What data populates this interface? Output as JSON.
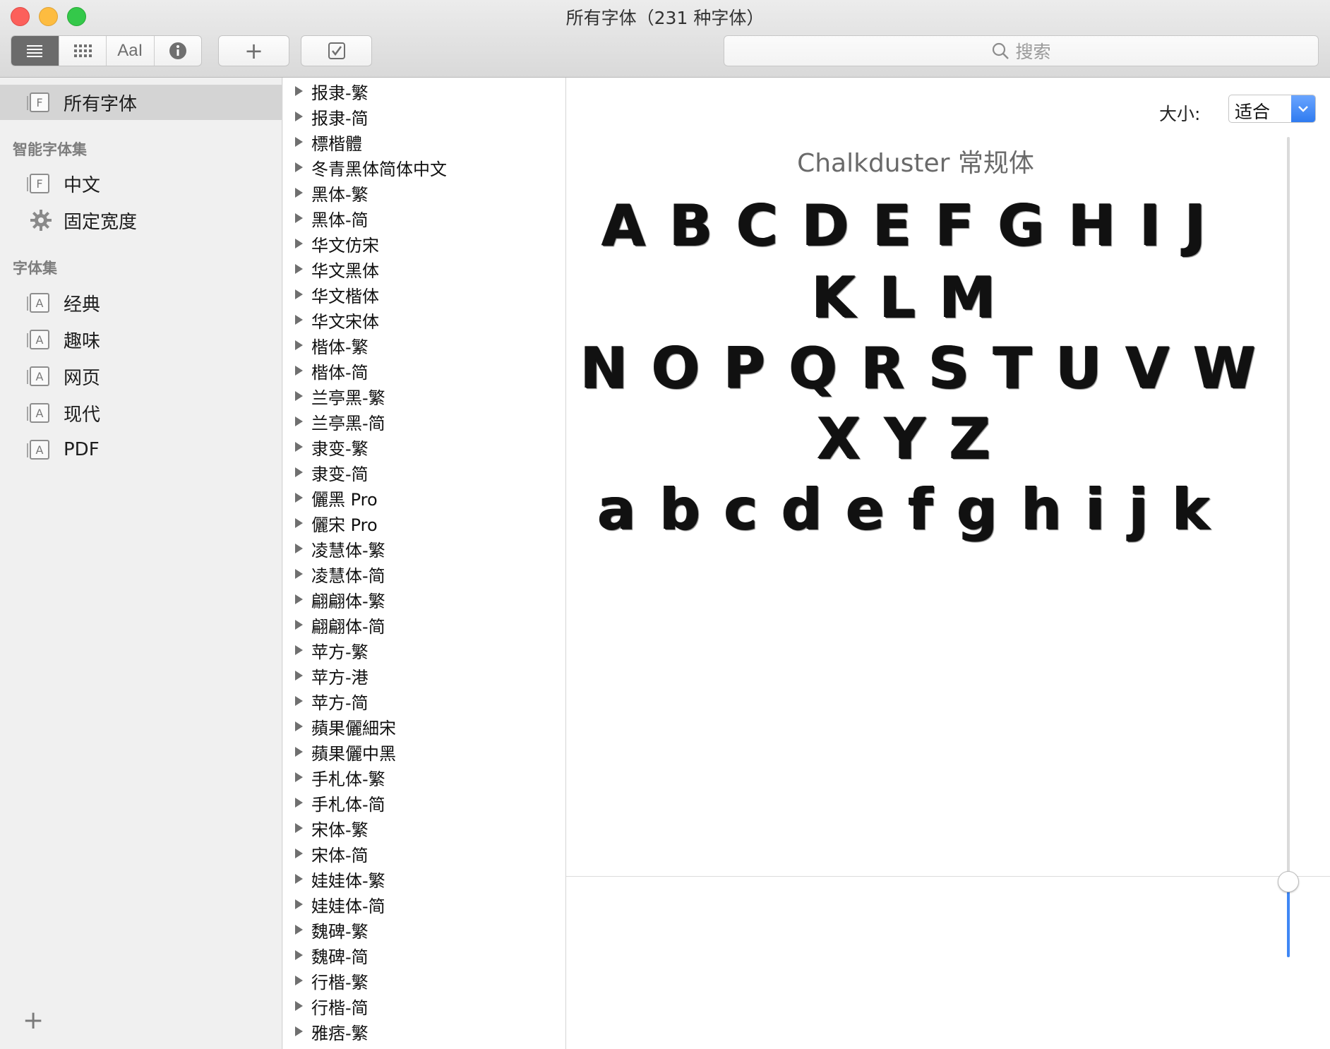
{
  "window": {
    "title": "所有字体（231 种字体）"
  },
  "toolbar": {
    "view_buttons": [
      {
        "name": "list-view-icon",
        "label": "≣"
      },
      {
        "name": "grid-view-icon",
        "label": "⋮⋮⋮"
      },
      {
        "name": "sample-view-icon",
        "label": "AaI"
      },
      {
        "name": "info-icon",
        "label": "ℹ"
      }
    ],
    "add_label": "+",
    "check_label": "✓",
    "search_placeholder": "搜索"
  },
  "sidebar": {
    "all_fonts": "所有字体",
    "smart_collections_heading": "智能字体集",
    "smart_collections": [
      {
        "label": "中文",
        "icon": "F"
      },
      {
        "label": "固定宽度",
        "icon": "gear"
      }
    ],
    "collections_heading": "字体集",
    "collections": [
      {
        "label": "经典",
        "icon": "A"
      },
      {
        "label": "趣味",
        "icon": "A"
      },
      {
        "label": "网页",
        "icon": "A"
      },
      {
        "label": "现代",
        "icon": "A"
      },
      {
        "label": "PDF",
        "icon": "A"
      }
    ],
    "add_label": "+"
  },
  "font_list": [
    "报隶-繁",
    "报隶-简",
    "標楷體",
    "冬青黑体简体中文",
    "黑体-繁",
    "黑体-简",
    "华文仿宋",
    "华文黑体",
    "华文楷体",
    "华文宋体",
    "楷体-繁",
    "楷体-简",
    "兰亭黑-繁",
    "兰亭黑-简",
    "隶变-繁",
    "隶变-简",
    "儷黑 Pro",
    "儷宋 Pro",
    "凌慧体-繁",
    "凌慧体-简",
    "翩翩体-繁",
    "翩翩体-简",
    "苹方-繁",
    "苹方-港",
    "苹方-简",
    "蘋果儷細宋",
    "蘋果儷中黑",
    "手札体-繁",
    "手札体-简",
    "宋体-繁",
    "宋体-简",
    "娃娃体-繁",
    "娃娃体-简",
    "魏碑-繁",
    "魏碑-简",
    "行楷-繁",
    "行楷-简",
    "雅痞-繁"
  ],
  "preview": {
    "size_label": "大小:",
    "size_value": "适合",
    "font_title": "Chalkduster 常规体",
    "sample_lines": [
      "ABCDEFGHIJ",
      "KLM",
      "NOPQRSTUVW",
      "XYZ",
      "abcdefghijk"
    ],
    "slider_value": 0.12
  },
  "colors": {
    "accent": "#3f87f5",
    "selected_bg": "#d4d4d4"
  }
}
